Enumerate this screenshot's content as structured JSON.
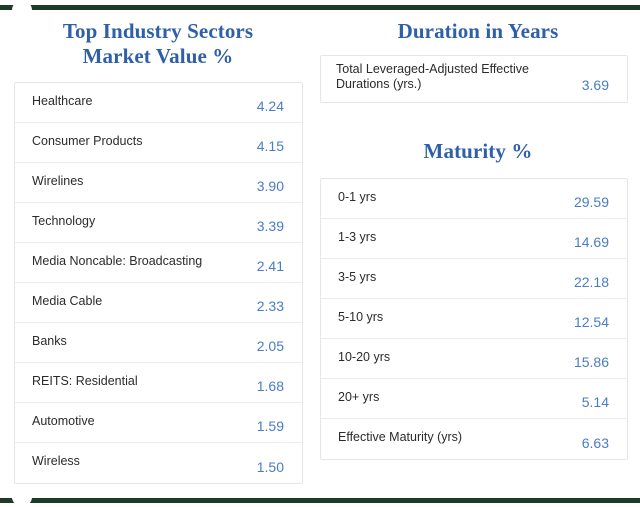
{
  "theme": {
    "heading_color": "#2e5fa8",
    "value_color": "#4a7cc7",
    "label_color": "#2b2b2b",
    "rule_color": "#1d3b26",
    "card_border_color": "#e6e6e6"
  },
  "left_panel": {
    "title_line1": "Top Industry Sectors",
    "title_line2": "Market Value %",
    "table": {
      "rows": [
        {
          "label": "Healthcare",
          "value": "4.24"
        },
        {
          "label": "Consumer Products",
          "value": "4.15"
        },
        {
          "label": "Wirelines",
          "value": "3.90"
        },
        {
          "label": "Technology",
          "value": "3.39"
        },
        {
          "label": "Media Noncable: Broadcasting",
          "value": "2.41"
        },
        {
          "label": "Media Cable",
          "value": "2.33"
        },
        {
          "label": "Banks",
          "value": "2.05"
        },
        {
          "label": "REITS: Residential",
          "value": "1.68"
        },
        {
          "label": "Automotive",
          "value": "1.59"
        },
        {
          "label": "Wireless",
          "value": "1.50"
        }
      ]
    }
  },
  "right_panel": {
    "duration": {
      "title": "Duration in Years",
      "rows": [
        {
          "label": "Total Leveraged-Adjusted Effective\nDurations (yrs.)",
          "value": "3.69"
        }
      ]
    },
    "maturity": {
      "title": "Maturity %",
      "rows": [
        {
          "label": "0-1 yrs",
          "value": "29.59"
        },
        {
          "label": "1-3 yrs",
          "value": "14.69"
        },
        {
          "label": "3-5 yrs",
          "value": "22.18"
        },
        {
          "label": "5-10 yrs",
          "value": "12.54"
        },
        {
          "label": "10-20 yrs",
          "value": "15.86"
        },
        {
          "label": "20+ yrs",
          "value": "5.14"
        },
        {
          "label": "Effective Maturity (yrs)",
          "value": "6.63"
        }
      ]
    }
  }
}
